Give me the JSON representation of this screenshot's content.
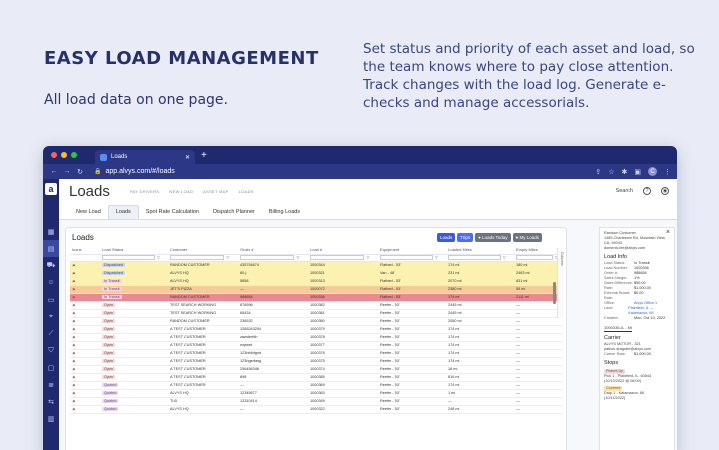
{
  "hero": {
    "title": "EASY LOAD MANAGEMENT",
    "subtitle": "All load data on one page.",
    "description": "Set status and priority of each asset and load, so the team knows where to pay close attention. Track changes with the load log. Generate e-checks and manage accessorials."
  },
  "browser": {
    "tab_title": "Loads",
    "url": "app.alvys.com/#/loads",
    "profile_initial": "C"
  },
  "app": {
    "logo": "a",
    "page_title": "Loads",
    "subnav": [
      "PAY DRIVERS",
      "NEW LOAD",
      "ASSET MAP",
      "LOADS"
    ],
    "search_label": "Search",
    "tabs": [
      "New Load",
      "Loads",
      "Spot Rate Calculation",
      "Dispatch Planner",
      "Billing Loads"
    ],
    "active_tab": "Loads"
  },
  "panel": {
    "title": "Loads",
    "buttons": [
      "Loads",
      "Trips",
      "Loads Today",
      "My Loads"
    ],
    "columns_label": "Columns",
    "headers": [
      "Icons",
      "Load Status",
      "Customer",
      "Order #",
      "Load #",
      "Equipment",
      "Loaded Miles",
      "Empty Miles"
    ],
    "rows": [
      {
        "icons": "",
        "status": "Dispatched",
        "customer": "RANDOM CUSTOMER",
        "order": "435754674",
        "load": "1000344",
        "equipment": "Flatbed - 53'",
        "loaded": "174 mi",
        "empty": "180 mi",
        "kind": "dispatched"
      },
      {
        "icons": "",
        "status": "Dispatched",
        "customer": "ALVYS HQ",
        "order": "80-j",
        "load": "1000321",
        "equipment": "Van - 48'",
        "loaded": "231 mi",
        "empty": "2463 mi",
        "kind": "dispatched"
      },
      {
        "icons": "",
        "status": "In Transit",
        "customer": "ALVYS HQ",
        "order": "5858",
        "load": "1000313",
        "equipment": "Flatbed - 53'",
        "loaded": "2070 mi",
        "empty": "831 mi",
        "kind": "dispatched"
      },
      {
        "icons": "",
        "status": "In Transit",
        "customer": "JET'S PIZZA",
        "order": "—",
        "load": "1000072",
        "equipment": "Flatbed - 53'",
        "loaded": "2380 mi",
        "empty": "59 mi",
        "kind": "intransit"
      },
      {
        "icons": "",
        "status": "In Transit",
        "customer": "RANDOM CUSTOMER",
        "order": "988654",
        "load": "1000336",
        "equipment": "Flatbed - 53'",
        "loaded": "174 mi",
        "empty": "2111 mi",
        "kind": "intransit-red"
      },
      {
        "icons": "",
        "status": "Open",
        "customer": "TEST SEARCH WORKING",
        "order": "876596",
        "load": "1000382",
        "equipment": "Reefer - 53'",
        "loaded": "2445 mi",
        "empty": "—",
        "kind": ""
      },
      {
        "icons": "",
        "status": "Open",
        "customer": "TEST SEARCH WORKING",
        "order": "65434",
        "load": "1000381",
        "equipment": "Reefer - 53'",
        "loaded": "2445 mi",
        "empty": "—",
        "kind": ""
      },
      {
        "icons": "",
        "status": "Open",
        "customer": "RANDOM CUSTOMER",
        "order": "236532",
        "load": "1000380",
        "equipment": "Reefer - 53'",
        "loaded": "2050 mi",
        "empty": "—",
        "kind": ""
      },
      {
        "icons": "",
        "status": "Open",
        "customer": "A TEST CUSTOMER",
        "order": "1265243254",
        "load": "1000379",
        "equipment": "Reefer - 53'",
        "loaded": "174 mi",
        "empty": "—",
        "kind": ""
      },
      {
        "icons": "",
        "status": "Open",
        "customer": "A TEST CUSTOMER",
        "order": "zawderfdh",
        "load": "1000378",
        "equipment": "Reefer - 53'",
        "loaded": "174 mi",
        "empty": "—",
        "kind": ""
      },
      {
        "icons": "",
        "status": "Open",
        "customer": "A TEST CUSTOMER",
        "order": "wqrwet",
        "load": "1000377",
        "equipment": "Reefer - 53'",
        "loaded": "174 mi",
        "empty": "—",
        "kind": ""
      },
      {
        "icons": "",
        "status": "Open",
        "customer": "A TEST CUSTOMER",
        "order": "123hfdhfgnd",
        "load": "1000376",
        "equipment": "Reefer - 53'",
        "loaded": "174 mi",
        "empty": "—",
        "kind": ""
      },
      {
        "icons": "",
        "status": "Open",
        "customer": "A TEST CUSTOMER",
        "order": "123hgerfasg",
        "load": "1000375",
        "equipment": "Reefer - 53'",
        "loaded": "174 mi",
        "empty": "—",
        "kind": ""
      },
      {
        "icons": "",
        "status": "Open",
        "customer": "A TEST CUSTOMER",
        "order": "256456346",
        "load": "1000374",
        "equipment": "Reefer - 53'",
        "loaded": "18 mi",
        "empty": "—",
        "kind": ""
      },
      {
        "icons": "",
        "status": "Open",
        "customer": "A TEST CUSTOMER",
        "order": "898",
        "load": "1000385",
        "equipment": "Reefer - 53'",
        "loaded": "816 mi",
        "empty": "—",
        "kind": ""
      },
      {
        "icons": "",
        "status": "Quoted",
        "customer": "A TEST CUSTOMER",
        "order": "—",
        "load": "1000369",
        "equipment": "Reefer - 53'",
        "loaded": "174 mi",
        "empty": "—",
        "kind": ""
      },
      {
        "icons": "",
        "status": "Quoted",
        "customer": "ALVYS HQ",
        "order": "12345677",
        "load": "1000363",
        "equipment": "Reefer - 53'",
        "loaded": "1 mi",
        "empty": "—",
        "kind": ""
      },
      {
        "icons": "",
        "status": "Quoted",
        "customer": "TLB",
        "order": "12310414",
        "load": "1000349",
        "equipment": "Reefer - 53'",
        "loaded": "—",
        "empty": "—",
        "kind": ""
      },
      {
        "icons": "",
        "status": "Quoted",
        "customer": "ALVYS HQ",
        "order": "—",
        "load": "1000322",
        "equipment": "Reefer - 53'",
        "loaded": "248 mi",
        "empty": "—",
        "kind": ""
      }
    ]
  },
  "detail": {
    "customer_lines": [
      "Random Customer",
      "1485 Charleston Rd, Mountain View, CA, 94043",
      "domenic.lee@alvys.com"
    ],
    "load_info_title": "Load Info",
    "load_info": [
      {
        "k": "Load Status:",
        "v": "In Transit"
      },
      {
        "k": "Load Number:",
        "v": "1000336"
      },
      {
        "k": "Order #:",
        "v": "988654"
      },
      {
        "k": "Sales Margin:",
        "v": "1%"
      },
      {
        "k": "Sales Difference:",
        "v": "$50.00"
      },
      {
        "k": "Rate:",
        "v": "$1,000.00"
      },
      {
        "k": "External Board:",
        "v": "$0.00"
      },
      {
        "k": "Rate:",
        "v": ""
      },
      {
        "k": "Office:",
        "v": "Alvys Office 1"
      },
      {
        "k": "Lane:",
        "v": "Plainfield, IL → Kalamazoo, MI"
      },
      {
        "k": "Created:",
        "v": "Mon, Oct 10, 2022"
      }
    ],
    "load_tab": "1000336-IL - MI",
    "carrier_title": "Carrier",
    "carrier_lines": [
      "ALVYS MOTOR - 321",
      "patrick.draguter@alvys.com"
    ],
    "carrier_rate_label": "Carrier Rate:",
    "carrier_rate": "$1,000.00",
    "stops_title": "Stops",
    "stops": [
      {
        "chip": "Picked Up",
        "kind": "pu",
        "lines": [
          "Pick 1 - Plainfield, IL, 60544",
          "(10/12/2022 @ 08:00)"
        ]
      },
      {
        "chip": "Covered",
        "kind": "del",
        "lines": [
          "Drop 1 - Kalamazoo, MI",
          "(10/11/2022)"
        ]
      }
    ]
  },
  "colors": {
    "brand": "#1f2a6e",
    "dispatched_row": "#fbf1b0",
    "intransit_row": "#f6cb9a",
    "alert_row": "#e98a92",
    "accent": "#3b5bdb"
  }
}
